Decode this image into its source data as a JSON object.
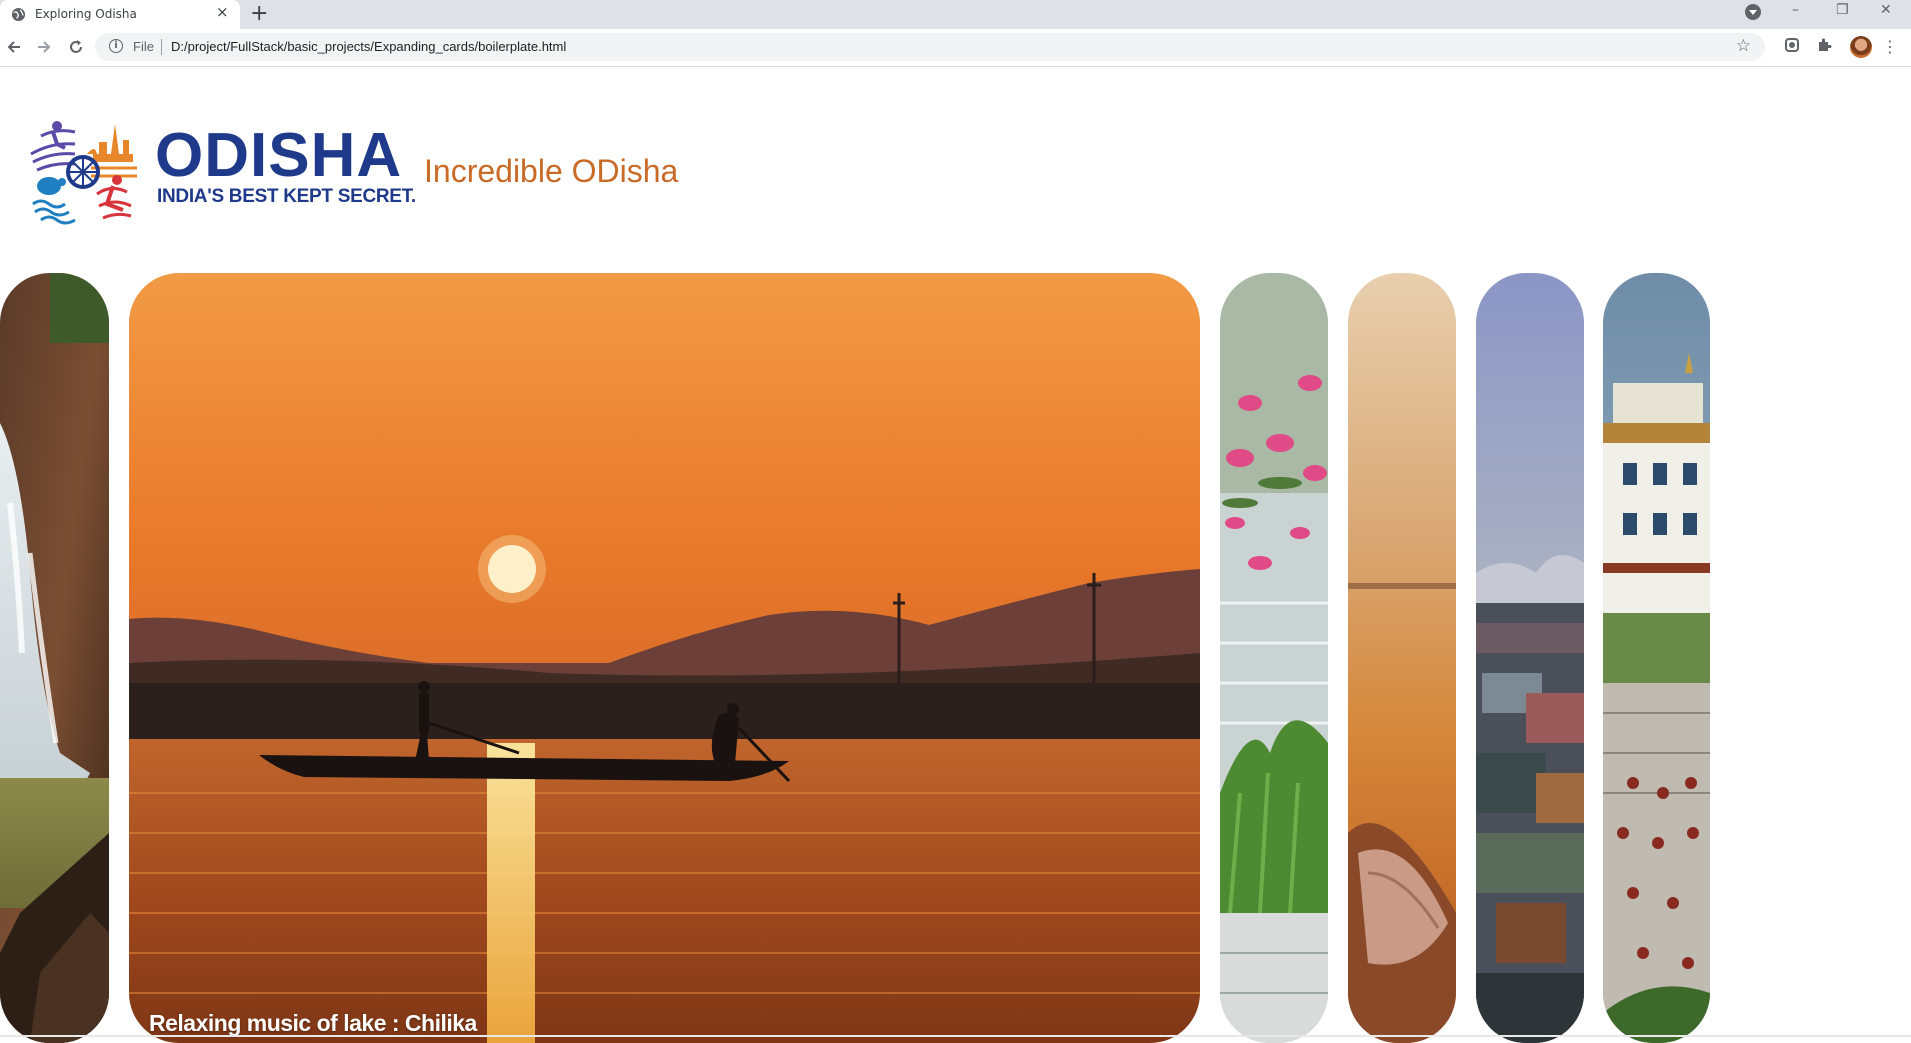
{
  "browser": {
    "tab_title": "Exploring Odisha",
    "tab_close": "×",
    "new_tab": "+",
    "address_scheme": "File",
    "address_url": "D:/project/FullStack/basic_projects/Expanding_cards/boilerplate.html",
    "window_controls": [
      "–",
      "❐",
      "✕"
    ]
  },
  "header": {
    "logo_word": "ODISHA",
    "logo_tagline": "INDIA'S BEST KEPT SECRET.",
    "headline": "Incredible ODisha"
  },
  "cards": [
    {
      "id": "waterfall",
      "caption": ""
    },
    {
      "id": "chilika",
      "caption": "Relaxing music of lake : Chilika",
      "active": true
    },
    {
      "id": "lotus",
      "caption": ""
    },
    {
      "id": "conch",
      "caption": ""
    },
    {
      "id": "town",
      "caption": ""
    },
    {
      "id": "monastery",
      "caption": ""
    }
  ],
  "colors": {
    "logo_blue": "#1f3a8a",
    "headline_orange": "#c96a27",
    "chrome_bg": "#dee1e6"
  }
}
